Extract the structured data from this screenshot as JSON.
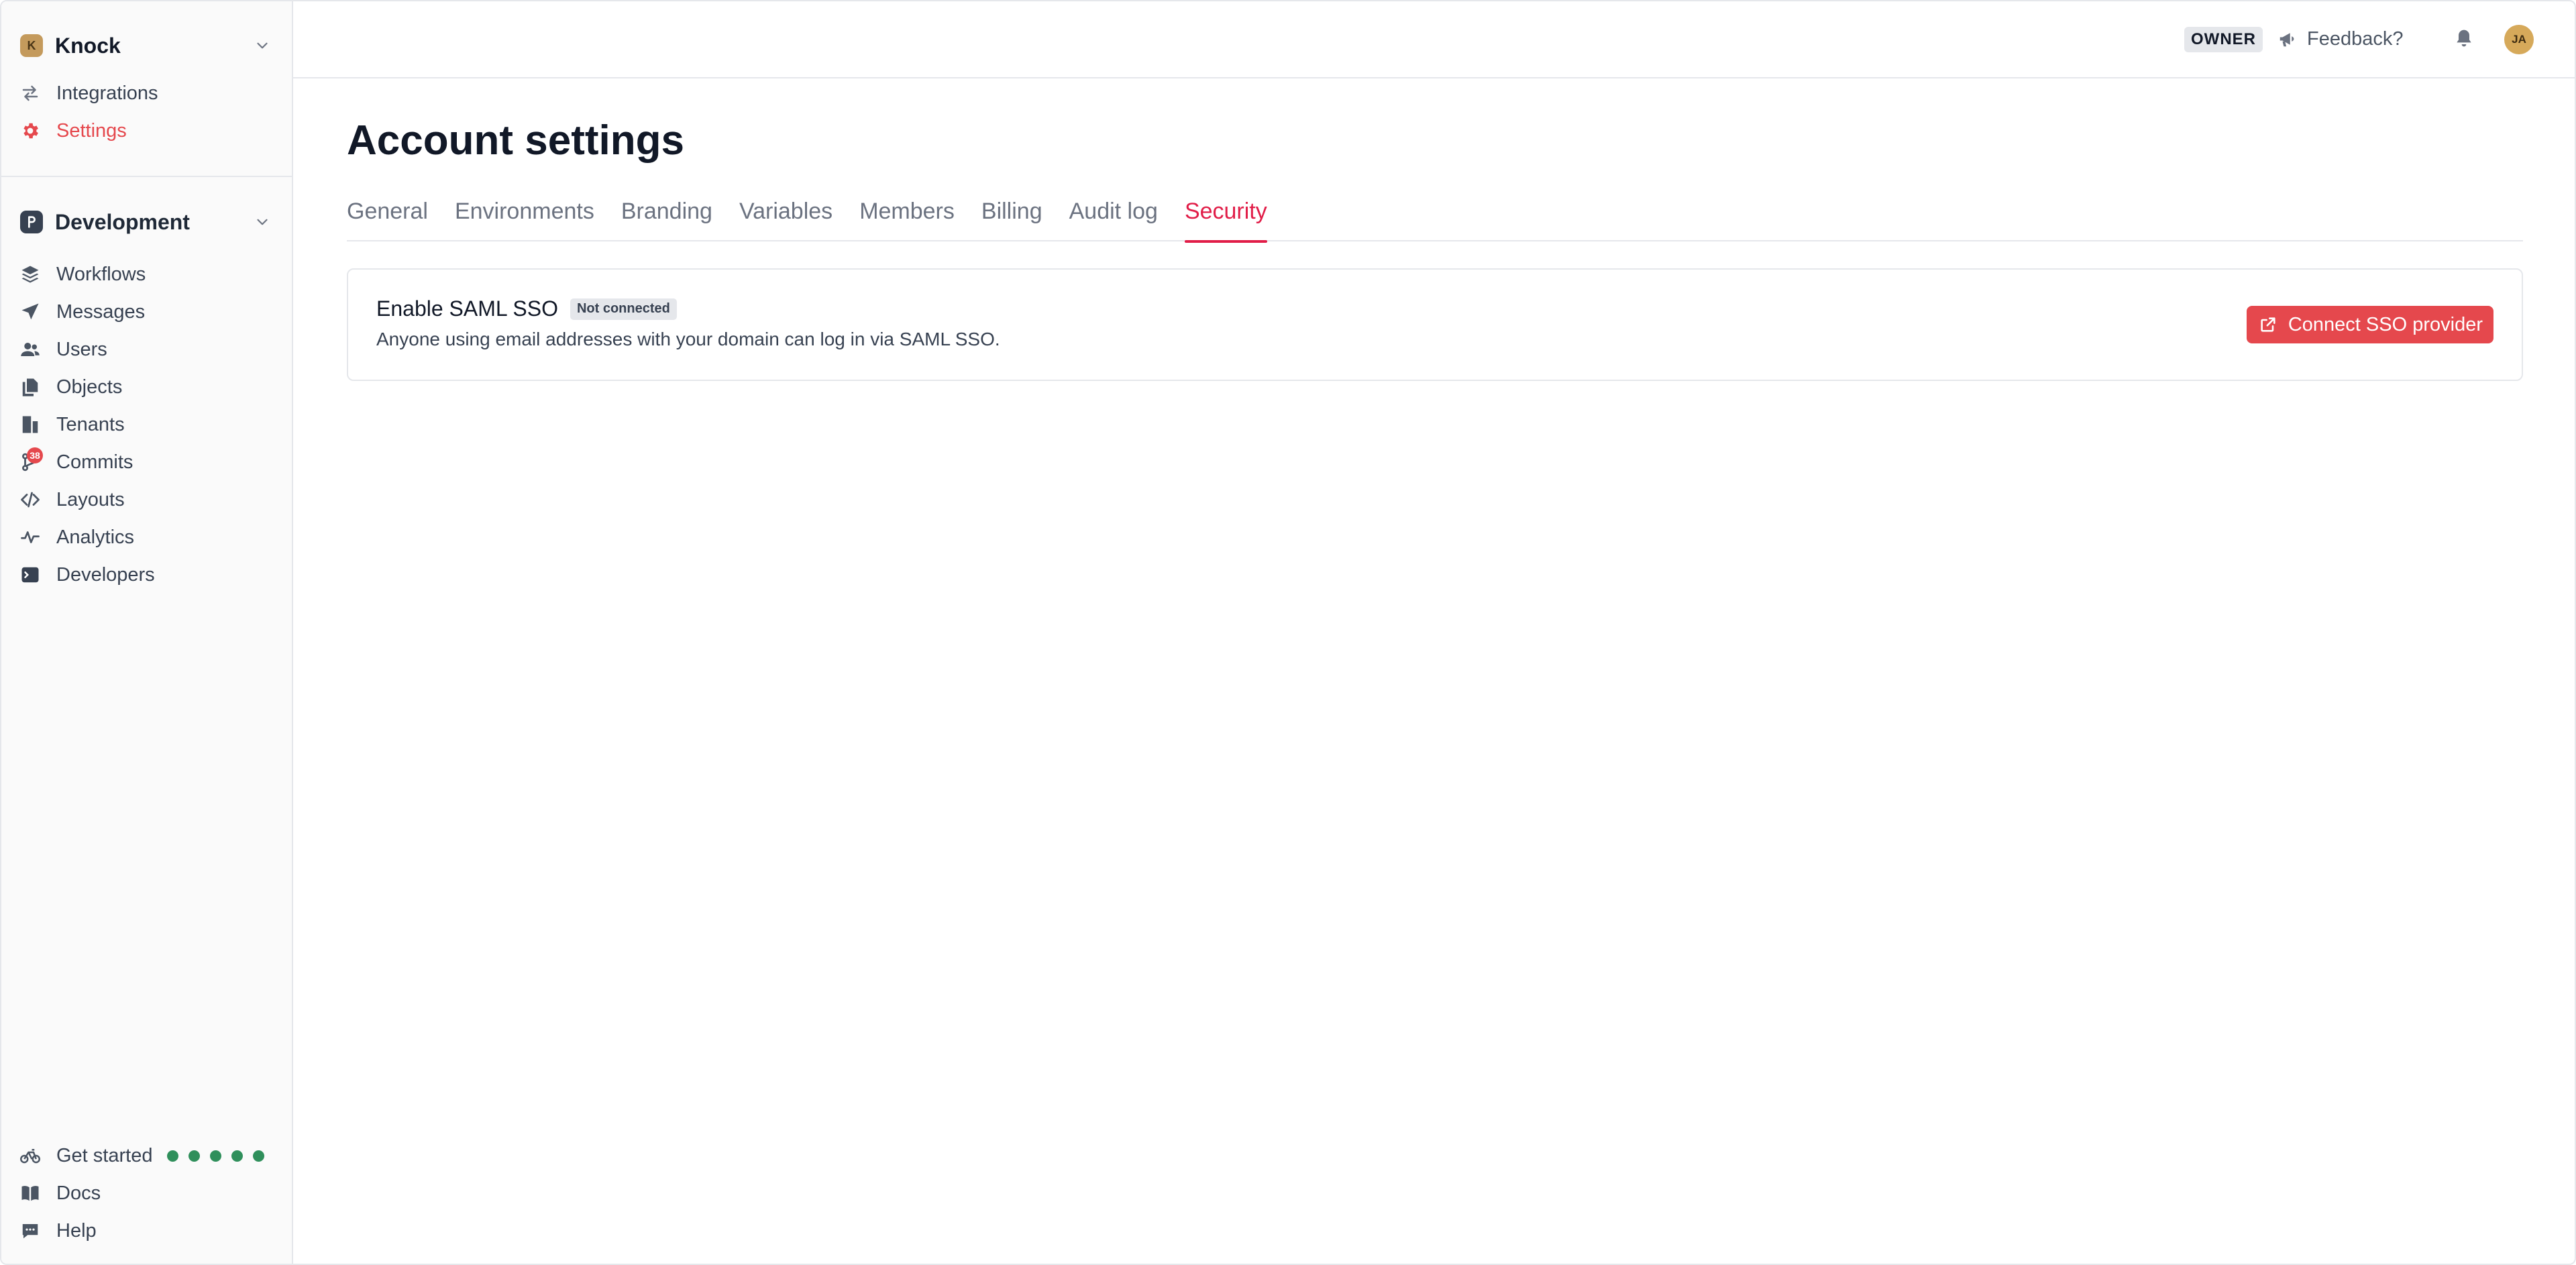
{
  "org": {
    "initial": "K",
    "name": "Knock"
  },
  "org_nav": [
    {
      "label": "Integrations",
      "icon": "arrows-swap-icon",
      "active": false
    },
    {
      "label": "Settings",
      "icon": "gear-icon",
      "active": true
    }
  ],
  "environment": {
    "name": "Development"
  },
  "env_nav": [
    {
      "label": "Workflows",
      "icon": "layers-icon"
    },
    {
      "label": "Messages",
      "icon": "paper-plane-icon"
    },
    {
      "label": "Users",
      "icon": "users-icon"
    },
    {
      "label": "Objects",
      "icon": "documents-icon"
    },
    {
      "label": "Tenants",
      "icon": "buildings-icon"
    },
    {
      "label": "Commits",
      "icon": "git-branch-icon",
      "badge": "38"
    },
    {
      "label": "Layouts",
      "icon": "code-icon"
    },
    {
      "label": "Analytics",
      "icon": "activity-icon"
    },
    {
      "label": "Developers",
      "icon": "terminal-icon"
    }
  ],
  "footer_nav": [
    {
      "label": "Get started",
      "icon": "bicycle-icon"
    },
    {
      "label": "Docs",
      "icon": "book-icon"
    },
    {
      "label": "Help",
      "icon": "chat-icon"
    }
  ],
  "topbar": {
    "role": "OWNER",
    "feedback_label": "Feedback?",
    "avatar_initials": "JA"
  },
  "page": {
    "title": "Account settings"
  },
  "tabs": [
    {
      "label": "General",
      "active": false
    },
    {
      "label": "Environments",
      "active": false
    },
    {
      "label": "Branding",
      "active": false
    },
    {
      "label": "Variables",
      "active": false
    },
    {
      "label": "Members",
      "active": false
    },
    {
      "label": "Billing",
      "active": false
    },
    {
      "label": "Audit log",
      "active": false
    },
    {
      "label": "Security",
      "active": true
    }
  ],
  "sso_card": {
    "title": "Enable SAML SSO",
    "status": "Not connected",
    "description": "Anyone using email addresses with your domain can log in via SAML SSO.",
    "button_label": "Connect SSO provider"
  },
  "colors": {
    "accent": "#e5484d",
    "active_tab": "#e11d48",
    "progress_dot": "#2f8f5b"
  }
}
